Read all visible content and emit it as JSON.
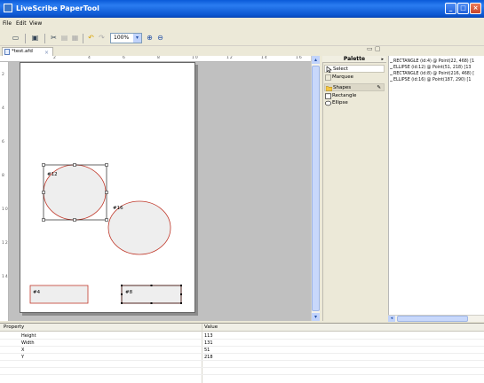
{
  "window": {
    "title": "LiveScribe PaperTool",
    "controls": [
      "minimize",
      "maximize",
      "close"
    ]
  },
  "menu": [
    "File",
    "Edit",
    "View"
  ],
  "toolbar": {
    "zoom": "100%"
  },
  "editor": {
    "tab_label": "*test.afd",
    "ruler_marks": [
      "2",
      "4",
      "6",
      "8",
      "10",
      "12",
      "14",
      "16"
    ],
    "shapes": [
      {
        "type": "ellipse",
        "label": "#12",
        "selected": true
      },
      {
        "type": "ellipse",
        "label": "#16",
        "selected": false
      },
      {
        "type": "rectangle",
        "label": "#4",
        "selected": false
      },
      {
        "type": "rectangle",
        "label": "#8",
        "selected": true
      }
    ]
  },
  "palette": {
    "header": "Palette",
    "items": [
      {
        "label": "Select",
        "icon": "arrow-cursor-icon"
      },
      {
        "label": "Marquee",
        "icon": "marquee-icon"
      },
      {
        "label": "Shapes",
        "icon": "folder-icon",
        "drawer": true
      },
      {
        "label": "Rectangle",
        "icon": "rectangle-icon"
      },
      {
        "label": "Ellipse",
        "icon": "ellipse-icon"
      }
    ]
  },
  "outline": [
    "RECTANGLE (id:4) @ Point(22, 468) [1",
    "ELLIPSE (id:12) @ Point(51, 218) [13",
    "RECTANGLE (id:8) @ Point(216, 468) [",
    "ELLIPSE (id:16) @ Point(187, 290) [1"
  ],
  "properties": {
    "columns": [
      "Property",
      "Value"
    ],
    "rows": [
      {
        "key": "Height",
        "value": "113"
      },
      {
        "key": "Width",
        "value": "131"
      },
      {
        "key": "X",
        "value": "51"
      },
      {
        "key": "Y",
        "value": "218"
      }
    ]
  },
  "colors": {
    "shape_stroke": "#c0392b",
    "shape_fill": "#eeeeee",
    "canvas_bg": "#c0c0c0",
    "title_bar": "#0a5ad8"
  }
}
